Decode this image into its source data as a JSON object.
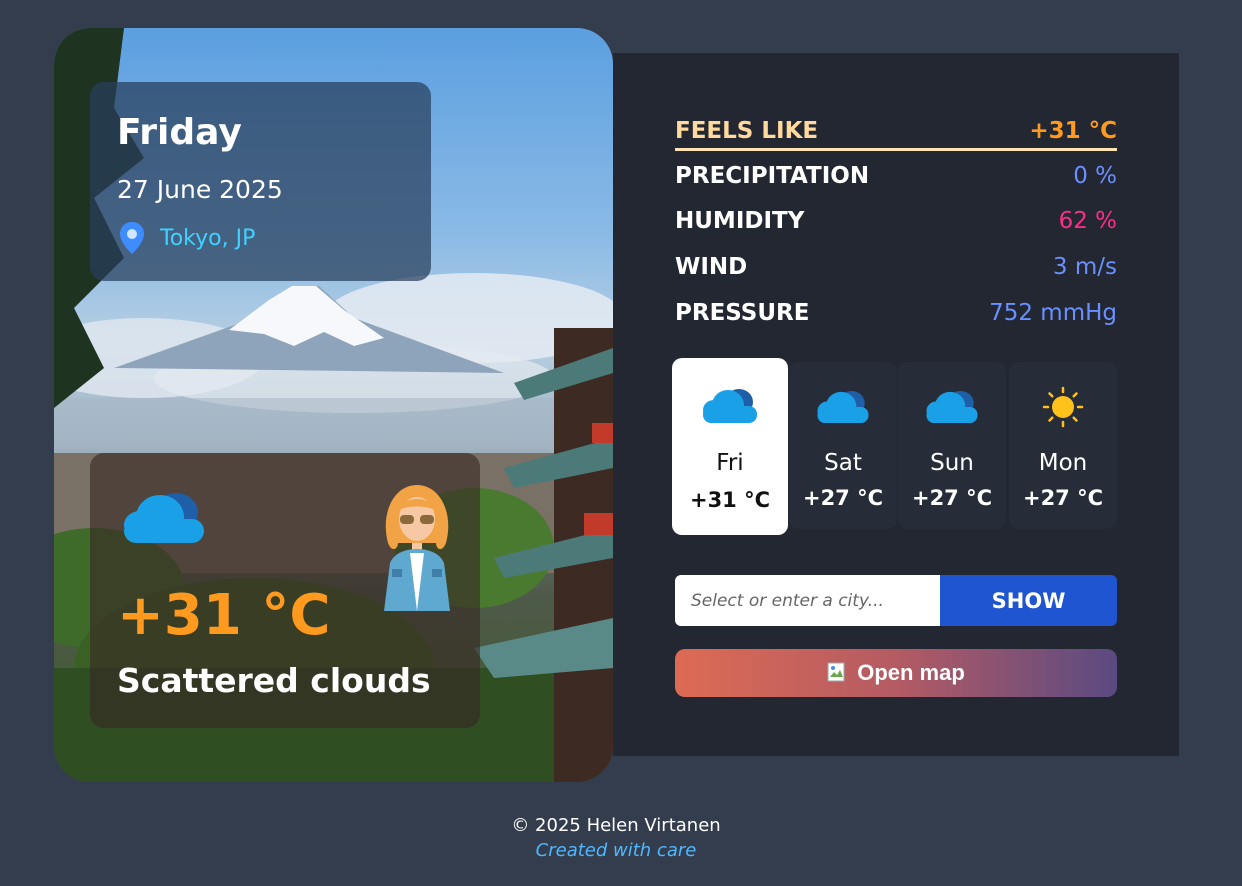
{
  "current": {
    "day": "Friday",
    "date": "27 June 2025",
    "location": "Tokyo, JP",
    "temperature": "+31 °C",
    "description": "Scattered clouds"
  },
  "details": {
    "feels_like": {
      "label": "FEELS LIKE",
      "value": "+31 °C"
    },
    "precipitation": {
      "label": "PRECIPITATION",
      "value": "0 %"
    },
    "humidity": {
      "label": "HUMIDITY",
      "value": "62 %"
    },
    "wind": {
      "label": "WIND",
      "value": "3 m/s"
    },
    "pressure": {
      "label": "PRESSURE",
      "value": "752 mmHg"
    }
  },
  "forecast": [
    {
      "day": "Fri",
      "temp": "+31 °C",
      "icon": "cloud-icon",
      "active": true
    },
    {
      "day": "Sat",
      "temp": "+27 °C",
      "icon": "cloud-icon",
      "active": false
    },
    {
      "day": "Sun",
      "temp": "+27 °C",
      "icon": "cloud-icon",
      "active": false
    },
    {
      "day": "Mon",
      "temp": "+27 °C",
      "icon": "sun-icon",
      "active": false
    }
  ],
  "search": {
    "placeholder": "Select or enter a city...",
    "button_label": "SHOW"
  },
  "map_button": {
    "label": "Open map"
  },
  "footer": {
    "copyright": "© 2025 Helen Virtanen",
    "credit": "Created with care"
  },
  "colors": {
    "background": "#343d4d",
    "panel": "#222731",
    "accent_orange": "#ff9a1f",
    "precipitation": "#6a8fff",
    "humidity": "#ff2d8a",
    "wind": "#6a8fff",
    "pressure": "#6a8fff",
    "location": "#3fd2ff",
    "show_button": "#1f55d0"
  }
}
